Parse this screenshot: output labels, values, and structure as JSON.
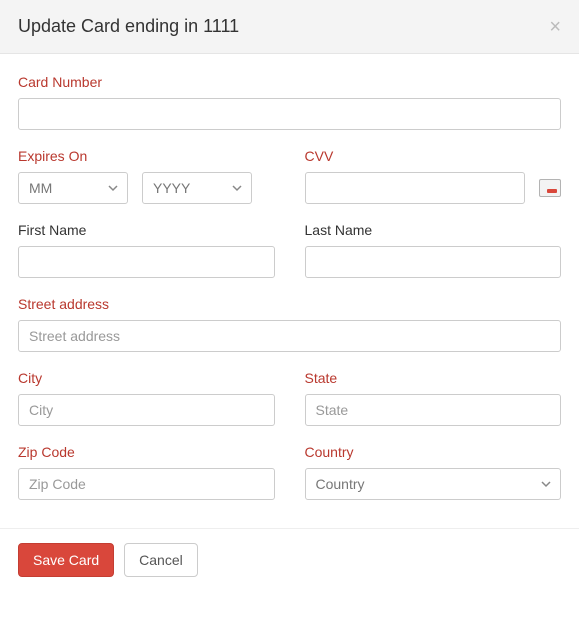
{
  "header": {
    "title": "Update Card ending in 1111"
  },
  "labels": {
    "card_number": "Card Number",
    "expires_on": "Expires On",
    "cvv": "CVV",
    "first_name": "First Name",
    "last_name": "Last Name",
    "street_address": "Street address",
    "city": "City",
    "state": "State",
    "zip_code": "Zip Code",
    "country": "Country"
  },
  "placeholders": {
    "street_address": "Street address",
    "city": "City",
    "state": "State",
    "zip_code": "Zip Code"
  },
  "select_defaults": {
    "month": "MM",
    "year": "YYYY",
    "country": "Country"
  },
  "values": {
    "card_number": "",
    "cvv": "",
    "first_name": "",
    "last_name": "",
    "street_address": "",
    "city": "",
    "state": "",
    "zip_code": ""
  },
  "footer": {
    "save_label": "Save Card",
    "cancel_label": "Cancel"
  }
}
